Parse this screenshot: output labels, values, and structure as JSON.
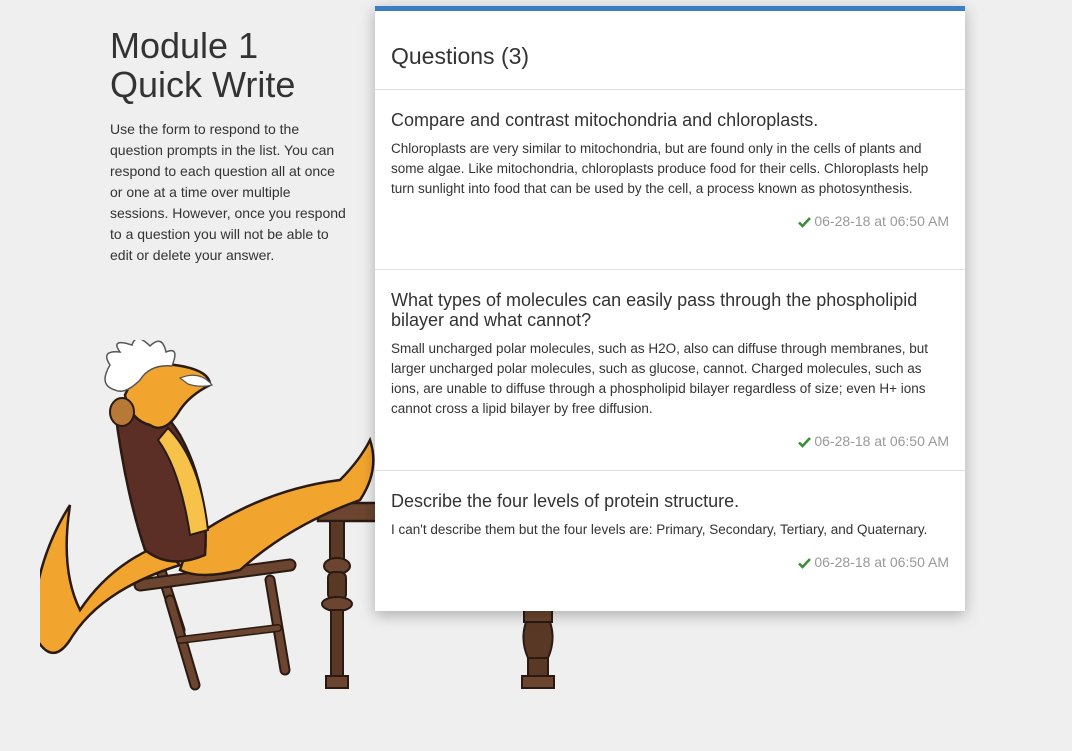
{
  "intro": {
    "title_line1": "Module 1",
    "title_line2": "Quick Write",
    "description": "Use the form to respond to the question prompts in the list. You can respond to each question all at once or one at a time over multiple sessions. However, once you respond to a question you will not be able to edit or delete your answer."
  },
  "questions": {
    "header": "Questions (3)",
    "items": [
      {
        "prompt": "Compare and contrast mitochondria and chloroplasts.",
        "answer": "Chloroplasts are very similar to mitochondria, but are found only in the cells of plants and some algae. Like mitochondria, chloroplasts produce food for their cells. Chloroplasts help turn sunlight into food that can be used by the cell, a process known as photosynthesis.",
        "timestamp": "06-28-18 at 06:50 AM",
        "status_icon": "check-icon"
      },
      {
        "prompt": "What types of molecules can easily pass through the phospholipid bilayer and what cannot?",
        "answer": "Small uncharged polar molecules, such as H2O, also can diffuse through membranes, but larger uncharged polar molecules, such as glucose, cannot. Charged molecules, such as ions, are unable to diffuse through a phospholipid bilayer regardless of size; even H+ ions cannot cross a lipid bilayer by free diffusion.",
        "timestamp": "06-28-18 at 06:50 AM",
        "status_icon": "check-icon"
      },
      {
        "prompt": "Describe the four levels of protein structure.",
        "answer": "I can't describe them but the four levels are: Primary, Secondary, Tertiary, and Quaternary.",
        "timestamp": "06-28-18 at 06:50 AM",
        "status_icon": "check-icon"
      }
    ]
  },
  "colors": {
    "accent": "#3a7fc1",
    "success": "#3c8f3c",
    "muted": "#999999",
    "background": "#efefef"
  },
  "illustration": {
    "subject": "lizard-professor-mascot"
  }
}
